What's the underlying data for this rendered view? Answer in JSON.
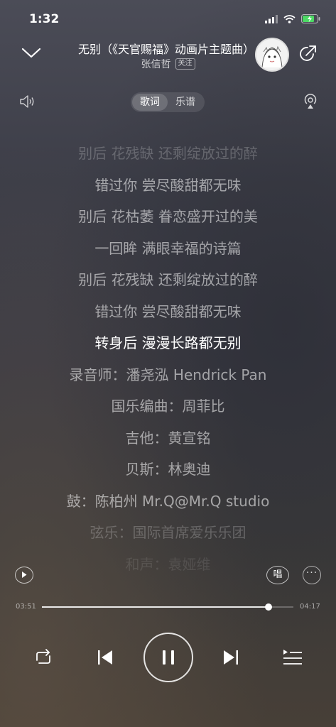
{
  "status_bar": {
    "time": "1:32"
  },
  "header": {
    "song_title": "无别（《天官赐福》动画片主题曲）",
    "artist": "张信哲",
    "follow_label": "关注"
  },
  "tabs": [
    {
      "label": "歌词",
      "active": true
    },
    {
      "label": "乐谱",
      "active": false
    }
  ],
  "lyrics": [
    {
      "text": "别后 花残缺 还剩绽放过的醉",
      "state": "fade1"
    },
    {
      "text": "错过你 尝尽酸甜都无味",
      "state": "normal"
    },
    {
      "text": "别后 花枯萎 眷恋盛开过的美",
      "state": "normal"
    },
    {
      "text": "一回眸 满眼幸福的诗篇",
      "state": "normal"
    },
    {
      "text": "别后 花残缺 还剩绽放过的醉",
      "state": "normal"
    },
    {
      "text": "错过你 尝尽酸甜都无味",
      "state": "normal"
    },
    {
      "text": "转身后 漫漫长路都无别",
      "state": "current"
    },
    {
      "text": "录音师：潘尧泓 Hendrick Pan",
      "state": "normal"
    },
    {
      "text": "国乐编曲：周菲比",
      "state": "normal"
    },
    {
      "text": "吉他：黄宣铭",
      "state": "normal"
    },
    {
      "text": "贝斯：林奥迪",
      "state": "normal"
    },
    {
      "text": "鼓：陈柏州 Mr.Q@Mr.Q studio",
      "state": "normal"
    },
    {
      "text": "弦乐：国际首席爱乐乐团",
      "state": "fade1"
    },
    {
      "text": "和声：袁娅维",
      "state": "fade2"
    }
  ],
  "actions": {
    "sing_label": "唱"
  },
  "progress": {
    "current": "03:51",
    "total": "04:17",
    "fraction": 0.9
  },
  "colors": {
    "background_top": "#4b4c57",
    "background_bottom": "#473f37",
    "text": "#ffffff"
  }
}
